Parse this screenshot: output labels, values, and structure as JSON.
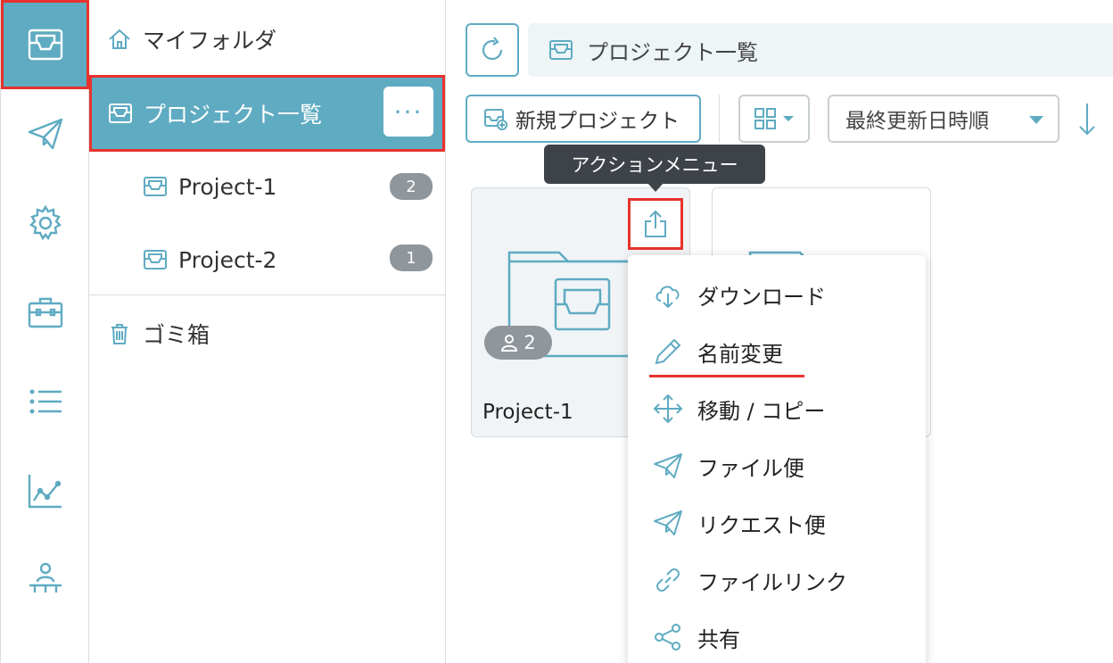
{
  "rail": {
    "items": [
      {
        "icon": "project-box-icon",
        "active": true
      },
      {
        "icon": "paper-plane-icon"
      },
      {
        "icon": "gear-icon"
      },
      {
        "icon": "toolbox-icon"
      },
      {
        "icon": "list-icon"
      },
      {
        "icon": "line-chart-icon"
      },
      {
        "icon": "org-chart-icon"
      }
    ]
  },
  "tree": {
    "my_folder": "マイフォルダ",
    "project_list": "プロジェクト一覧",
    "more": "···",
    "projects": [
      {
        "name": "Project-1",
        "count": "2"
      },
      {
        "name": "Project-2",
        "count": "1"
      }
    ],
    "trash": "ゴミ箱"
  },
  "header": {
    "breadcrumb": "プロジェクト一覧"
  },
  "toolbar": {
    "new_project": "新規プロジェクト",
    "sort": "最終更新日時順"
  },
  "tooltip": {
    "text": "アクションメニュー"
  },
  "cards": [
    {
      "name": "Project-1",
      "members": "2"
    }
  ],
  "menu": {
    "items": [
      {
        "label": "ダウンロード",
        "icon": "cloud-download-icon"
      },
      {
        "label": "名前変更",
        "icon": "pencil-icon"
      },
      {
        "label": "移動 / コピー",
        "icon": "move-arrows-icon"
      },
      {
        "label": "ファイル便",
        "icon": "paper-plane-icon"
      },
      {
        "label": "リクエスト便",
        "icon": "paper-plane-icon"
      },
      {
        "label": "ファイルリンク",
        "icon": "link-icon"
      },
      {
        "label": "共有",
        "icon": "share-icon"
      }
    ]
  },
  "colors": {
    "accent": "#5fabc2",
    "highlight": "#e8322e"
  }
}
